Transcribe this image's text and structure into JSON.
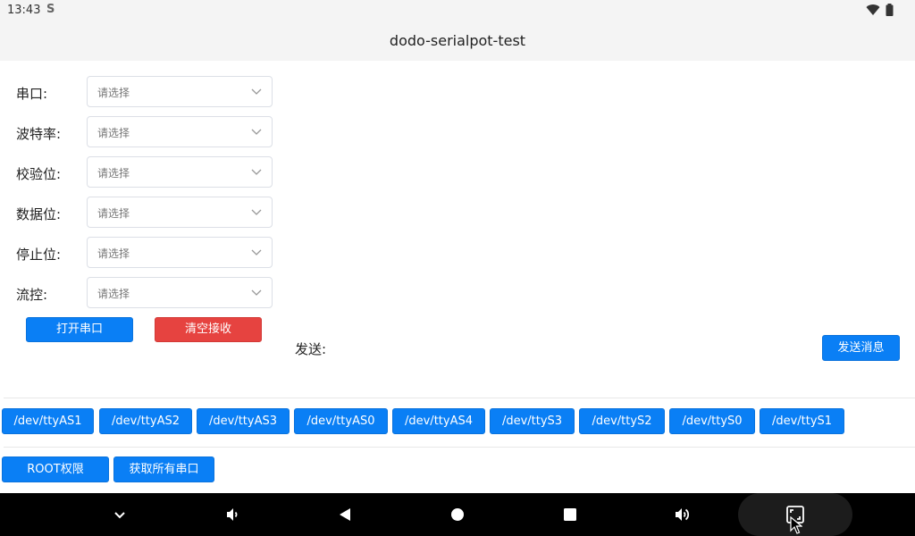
{
  "status": {
    "time": "13:43"
  },
  "app": {
    "title": "dodo-serialpot-test"
  },
  "form": {
    "fields": [
      {
        "label": "串口:",
        "placeholder": "请选择"
      },
      {
        "label": "波特率:",
        "placeholder": "请选择"
      },
      {
        "label": "校验位:",
        "placeholder": "请选择"
      },
      {
        "label": "数据位:",
        "placeholder": "请选择"
      },
      {
        "label": "停止位:",
        "placeholder": "请选择"
      },
      {
        "label": "流控:",
        "placeholder": "请选择"
      }
    ],
    "open_button": "打开串口",
    "clear_button": "清空接收"
  },
  "send": {
    "label": "发送:",
    "button": "发送消息"
  },
  "ports": [
    "/dev/ttyAS1",
    "/dev/ttyAS2",
    "/dev/ttyAS3",
    "/dev/ttyAS0",
    "/dev/ttyAS4",
    "/dev/ttyS3",
    "/dev/ttyS2",
    "/dev/ttyS0",
    "/dev/ttyS1"
  ],
  "actions": {
    "root_button": "ROOT权限",
    "get_ports_button": "获取所有串口"
  },
  "colors": {
    "primary": "#0a7ff5",
    "danger": "#e64340",
    "nav_bg": "#000000"
  },
  "nav_icons": [
    "chevron-down-icon",
    "volume-down-icon",
    "back-icon",
    "home-icon",
    "recents-icon",
    "volume-up-icon",
    "screenshot-icon"
  ]
}
